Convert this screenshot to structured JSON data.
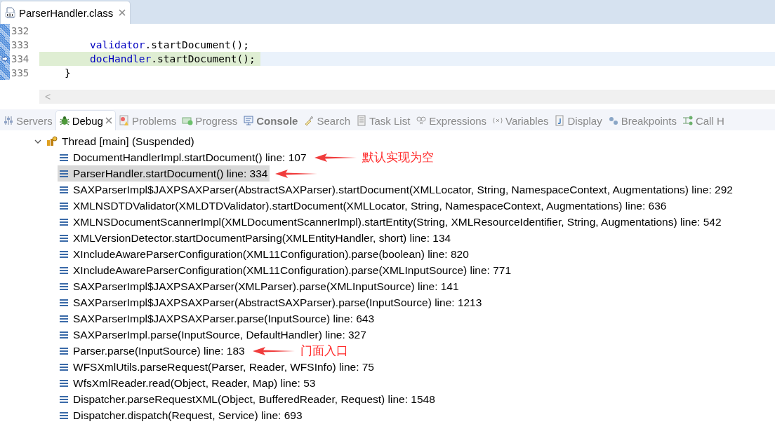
{
  "editor": {
    "tab": {
      "title": "ParserHandler.class",
      "selected": true
    },
    "lines": [
      {
        "number": "332",
        "current": false
      },
      {
        "number": "333",
        "current": false,
        "tokens": [
          {
            "kind": "field",
            "text": "validator"
          },
          {
            "kind": "plain",
            "text": ".startDocument();"
          }
        ]
      },
      {
        "number": "334",
        "current": true,
        "tokens": [
          {
            "kind": "field",
            "text": "docHandler"
          },
          {
            "kind": "plain",
            "text": ".startDocument();"
          }
        ]
      },
      {
        "number": "335",
        "current": false,
        "tokens": [
          {
            "kind": "plain",
            "text": "}"
          }
        ]
      }
    ],
    "scroll_arrow": "<"
  },
  "views": {
    "tabs": [
      {
        "label": "Servers",
        "kind": "servers",
        "selected": false
      },
      {
        "label": "Debug",
        "kind": "debug",
        "selected": true
      },
      {
        "label": "Problems",
        "kind": "problems",
        "selected": false
      },
      {
        "label": "Progress",
        "kind": "progress",
        "selected": false
      },
      {
        "label": "Console",
        "kind": "console",
        "selected": false
      },
      {
        "label": "Search",
        "kind": "search",
        "selected": false
      },
      {
        "label": "Task List",
        "kind": "tasks",
        "selected": false
      },
      {
        "label": "Expressions",
        "kind": "expressions",
        "selected": false
      },
      {
        "label": "Variables",
        "kind": "variables",
        "selected": false
      },
      {
        "label": "Display",
        "kind": "display",
        "selected": false
      },
      {
        "label": "Breakpoints",
        "kind": "breakpoints",
        "selected": false
      },
      {
        "label": "Call H",
        "kind": "callh",
        "selected": false
      }
    ]
  },
  "debug": {
    "thread": {
      "label": "Thread [main] (Suspended)",
      "expanded": true,
      "frames": [
        {
          "label": "DocumentHandlerImpl.startDocument() line: 107",
          "selected": false,
          "arrow": true,
          "note": "默认实现为空"
        },
        {
          "label": "ParserHandler.startDocument() line: 334",
          "selected": true,
          "arrow": true
        },
        {
          "label": "SAXParserImpl$JAXPSAXParser(AbstractSAXParser).startDocument(XMLLocator, String, NamespaceContext, Augmentations) line: 292",
          "selected": false
        },
        {
          "label": "XMLNSDTDValidator(XMLDTDValidator).startDocument(XMLLocator, String, NamespaceContext, Augmentations) line: 636",
          "selected": false
        },
        {
          "label": "XMLNSDocumentScannerImpl(XMLDocumentScannerImpl).startEntity(String, XMLResourceIdentifier, String, Augmentations) line: 542",
          "selected": false
        },
        {
          "label": "XMLVersionDetector.startDocumentParsing(XMLEntityHandler, short) line: 134",
          "selected": false
        },
        {
          "label": "XIncludeAwareParserConfiguration(XML11Configuration).parse(boolean) line: 820",
          "selected": false
        },
        {
          "label": "XIncludeAwareParserConfiguration(XML11Configuration).parse(XMLInputSource) line: 771",
          "selected": false
        },
        {
          "label": "SAXParserImpl$JAXPSAXParser(XMLParser).parse(XMLInputSource) line: 141",
          "selected": false
        },
        {
          "label": "SAXParserImpl$JAXPSAXParser(AbstractSAXParser).parse(InputSource) line: 1213",
          "selected": false
        },
        {
          "label": "SAXParserImpl$JAXPSAXParser.parse(InputSource) line: 643",
          "selected": false
        },
        {
          "label": "SAXParserImpl.parse(InputSource, DefaultHandler) line: 327",
          "selected": false
        },
        {
          "label": "Parser.parse(InputSource) line: 183",
          "selected": false,
          "arrow": true,
          "note": "门面入口"
        },
        {
          "label": "WFSXmlUtils.parseRequest(Parser, Reader, WFSInfo) line: 75",
          "selected": false
        },
        {
          "label": "WfsXmlReader.read(Object, Reader, Map) line: 53",
          "selected": false
        },
        {
          "label": "Dispatcher.parseRequestXML(Object, BufferedReader, Request) line: 1548",
          "selected": false
        },
        {
          "label": "Dispatcher.dispatch(Request, Service) line: 693",
          "selected": false
        }
      ]
    }
  }
}
